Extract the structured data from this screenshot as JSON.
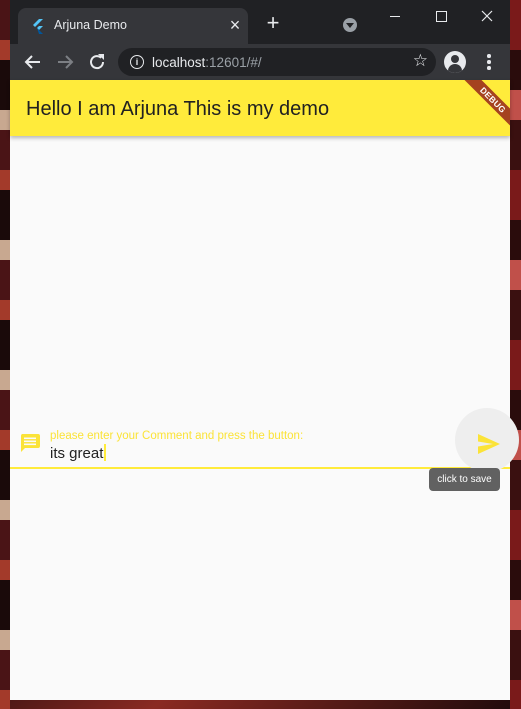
{
  "browser": {
    "tab_title": "Arjuna Demo",
    "tab_close": "×",
    "new_tab": "+",
    "url_host": "localhost",
    "url_rest": ":12601/#/",
    "info": "i",
    "star": "☆"
  },
  "app": {
    "title": "Hello I am Arjuna This is my demo",
    "debug_banner": "DEBUG",
    "accent_color": "#ffeb3b"
  },
  "comment_field": {
    "label": "please enter your Comment and press the button:",
    "value": "its great"
  },
  "send_button": {
    "tooltip": "click to save"
  },
  "icons": {
    "favicon": "flutter-icon",
    "comment": "comment-icon",
    "send": "send-icon"
  }
}
